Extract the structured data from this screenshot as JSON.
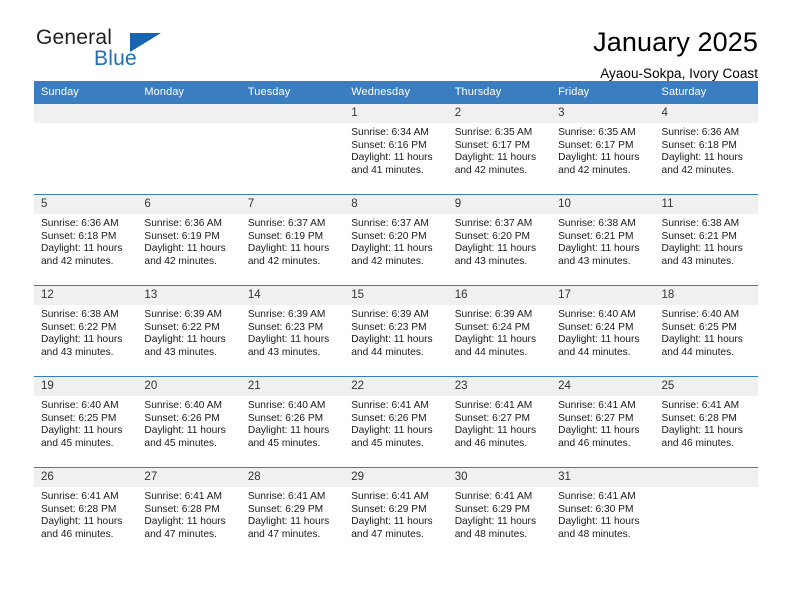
{
  "brand": {
    "name_part1": "General",
    "name_part2": "Blue",
    "triangle_color": "#1565b0",
    "blue_color": "#1f6eb5"
  },
  "header": {
    "month_title": "January 2025",
    "location": "Ayaou-Sokpa, Ivory Coast"
  },
  "theme": {
    "header_bg": "#3a7dc0",
    "daynum_bg": "#f0f0f0",
    "grid_line": "#3a7dc0"
  },
  "calendar": {
    "weekday_headers": [
      "Sunday",
      "Monday",
      "Tuesday",
      "Wednesday",
      "Thursday",
      "Friday",
      "Saturday"
    ],
    "weeks": [
      [
        {
          "day": "",
          "info": ""
        },
        {
          "day": "",
          "info": ""
        },
        {
          "day": "",
          "info": ""
        },
        {
          "day": "1",
          "info": "Sunrise: 6:34 AM\nSunset: 6:16 PM\nDaylight: 11 hours\nand 41 minutes."
        },
        {
          "day": "2",
          "info": "Sunrise: 6:35 AM\nSunset: 6:17 PM\nDaylight: 11 hours\nand 42 minutes."
        },
        {
          "day": "3",
          "info": "Sunrise: 6:35 AM\nSunset: 6:17 PM\nDaylight: 11 hours\nand 42 minutes."
        },
        {
          "day": "4",
          "info": "Sunrise: 6:36 AM\nSunset: 6:18 PM\nDaylight: 11 hours\nand 42 minutes."
        }
      ],
      [
        {
          "day": "5",
          "info": "Sunrise: 6:36 AM\nSunset: 6:18 PM\nDaylight: 11 hours\nand 42 minutes."
        },
        {
          "day": "6",
          "info": "Sunrise: 6:36 AM\nSunset: 6:19 PM\nDaylight: 11 hours\nand 42 minutes."
        },
        {
          "day": "7",
          "info": "Sunrise: 6:37 AM\nSunset: 6:19 PM\nDaylight: 11 hours\nand 42 minutes."
        },
        {
          "day": "8",
          "info": "Sunrise: 6:37 AM\nSunset: 6:20 PM\nDaylight: 11 hours\nand 42 minutes."
        },
        {
          "day": "9",
          "info": "Sunrise: 6:37 AM\nSunset: 6:20 PM\nDaylight: 11 hours\nand 43 minutes."
        },
        {
          "day": "10",
          "info": "Sunrise: 6:38 AM\nSunset: 6:21 PM\nDaylight: 11 hours\nand 43 minutes."
        },
        {
          "day": "11",
          "info": "Sunrise: 6:38 AM\nSunset: 6:21 PM\nDaylight: 11 hours\nand 43 minutes."
        }
      ],
      [
        {
          "day": "12",
          "info": "Sunrise: 6:38 AM\nSunset: 6:22 PM\nDaylight: 11 hours\nand 43 minutes."
        },
        {
          "day": "13",
          "info": "Sunrise: 6:39 AM\nSunset: 6:22 PM\nDaylight: 11 hours\nand 43 minutes."
        },
        {
          "day": "14",
          "info": "Sunrise: 6:39 AM\nSunset: 6:23 PM\nDaylight: 11 hours\nand 43 minutes."
        },
        {
          "day": "15",
          "info": "Sunrise: 6:39 AM\nSunset: 6:23 PM\nDaylight: 11 hours\nand 44 minutes."
        },
        {
          "day": "16",
          "info": "Sunrise: 6:39 AM\nSunset: 6:24 PM\nDaylight: 11 hours\nand 44 minutes."
        },
        {
          "day": "17",
          "info": "Sunrise: 6:40 AM\nSunset: 6:24 PM\nDaylight: 11 hours\nand 44 minutes."
        },
        {
          "day": "18",
          "info": "Sunrise: 6:40 AM\nSunset: 6:25 PM\nDaylight: 11 hours\nand 44 minutes."
        }
      ],
      [
        {
          "day": "19",
          "info": "Sunrise: 6:40 AM\nSunset: 6:25 PM\nDaylight: 11 hours\nand 45 minutes."
        },
        {
          "day": "20",
          "info": "Sunrise: 6:40 AM\nSunset: 6:26 PM\nDaylight: 11 hours\nand 45 minutes."
        },
        {
          "day": "21",
          "info": "Sunrise: 6:40 AM\nSunset: 6:26 PM\nDaylight: 11 hours\nand 45 minutes."
        },
        {
          "day": "22",
          "info": "Sunrise: 6:41 AM\nSunset: 6:26 PM\nDaylight: 11 hours\nand 45 minutes."
        },
        {
          "day": "23",
          "info": "Sunrise: 6:41 AM\nSunset: 6:27 PM\nDaylight: 11 hours\nand 46 minutes."
        },
        {
          "day": "24",
          "info": "Sunrise: 6:41 AM\nSunset: 6:27 PM\nDaylight: 11 hours\nand 46 minutes."
        },
        {
          "day": "25",
          "info": "Sunrise: 6:41 AM\nSunset: 6:28 PM\nDaylight: 11 hours\nand 46 minutes."
        }
      ],
      [
        {
          "day": "26",
          "info": "Sunrise: 6:41 AM\nSunset: 6:28 PM\nDaylight: 11 hours\nand 46 minutes."
        },
        {
          "day": "27",
          "info": "Sunrise: 6:41 AM\nSunset: 6:28 PM\nDaylight: 11 hours\nand 47 minutes."
        },
        {
          "day": "28",
          "info": "Sunrise: 6:41 AM\nSunset: 6:29 PM\nDaylight: 11 hours\nand 47 minutes."
        },
        {
          "day": "29",
          "info": "Sunrise: 6:41 AM\nSunset: 6:29 PM\nDaylight: 11 hours\nand 47 minutes."
        },
        {
          "day": "30",
          "info": "Sunrise: 6:41 AM\nSunset: 6:29 PM\nDaylight: 11 hours\nand 48 minutes."
        },
        {
          "day": "31",
          "info": "Sunrise: 6:41 AM\nSunset: 6:30 PM\nDaylight: 11 hours\nand 48 minutes."
        },
        {
          "day": "",
          "info": ""
        }
      ]
    ]
  }
}
